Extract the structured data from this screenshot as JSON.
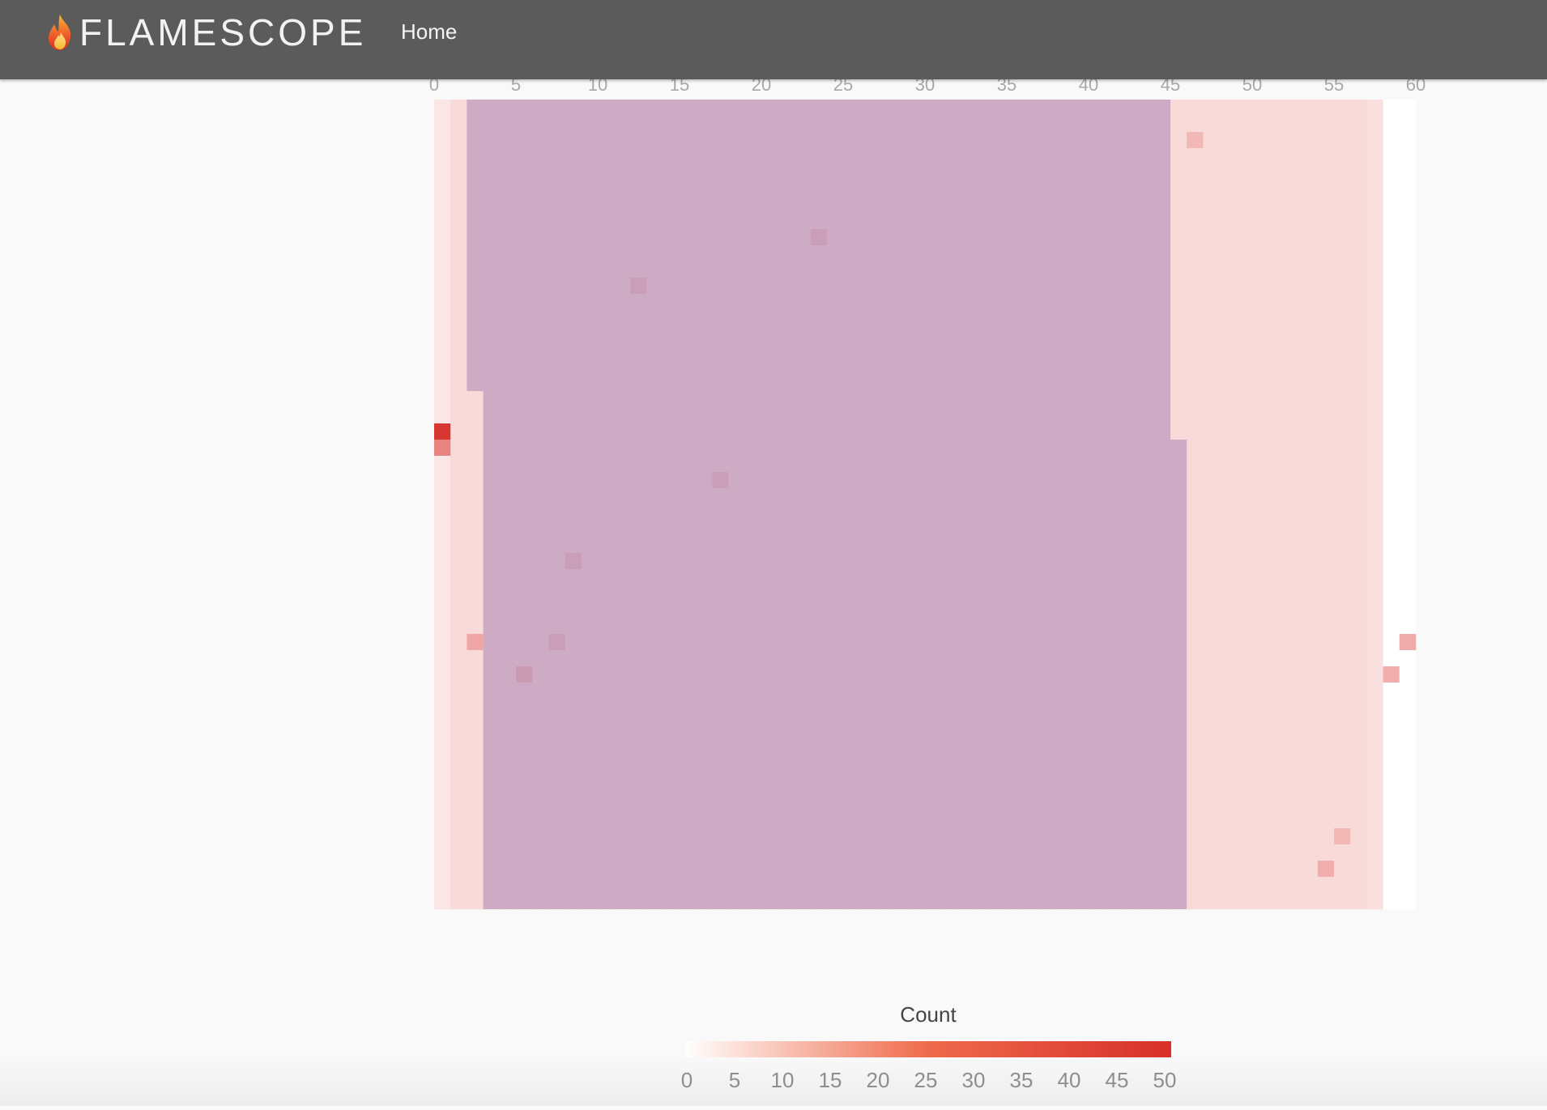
{
  "app": {
    "brand": "FLAMESCOPE",
    "brand_icon": "flame-icon",
    "nav": [
      {
        "label": "Home"
      }
    ]
  },
  "colors": {
    "navbar": "#5b5b5b",
    "selection": "#b28cb8",
    "scale_low": "#ffffff",
    "scale_high": "#d7302b"
  },
  "chart_data": {
    "type": "heatmap",
    "x_ticks": [
      "0",
      "5",
      "10",
      "15",
      "20",
      "25",
      "30",
      "35",
      "40",
      "45",
      "50",
      "55",
      "60"
    ],
    "xlim": [
      0,
      60
    ],
    "rows": 50,
    "columns": 60,
    "base_counts": {
      "column_0": 3,
      "columns_1_to_56": 5,
      "column_57": 4,
      "columns_58_to_59": 0
    },
    "notable_cells": [
      {
        "column": 0,
        "row": 20,
        "count": 48
      },
      {
        "column": 0,
        "row": 21,
        "count": 25
      },
      {
        "column": 2,
        "row": 33,
        "count": 16
      },
      {
        "column": 59,
        "row": 33,
        "count": 15
      },
      {
        "column": 58,
        "row": 35,
        "count": 14
      },
      {
        "column": 46,
        "row": 2,
        "count": 12
      },
      {
        "column": 54,
        "row": 47,
        "count": 14
      },
      {
        "column": 55,
        "row": 45,
        "count": 12
      },
      {
        "column": 5,
        "row": 35,
        "count": 14
      },
      {
        "column": 7,
        "row": 33,
        "count": 12
      },
      {
        "column": 8,
        "row": 28,
        "count": 12
      },
      {
        "column": 17,
        "row": 23,
        "count": 12
      },
      {
        "column": 23,
        "row": 8,
        "count": 12
      },
      {
        "column": 12,
        "row": 11,
        "count": 12
      }
    ],
    "selection": {
      "rows_0_to_17": {
        "start_column": 2,
        "end_column": 44
      },
      "rows_18_to_20": {
        "start_column": 3,
        "end_column": 44
      },
      "rows_21_to_49": {
        "start_column": 3,
        "end_column": 45
      }
    },
    "legend": {
      "title": "Count",
      "ticks": [
        "0",
        "5",
        "10",
        "15",
        "20",
        "25",
        "30",
        "35",
        "40",
        "45",
        "50"
      ],
      "range": [
        0,
        50
      ]
    }
  }
}
